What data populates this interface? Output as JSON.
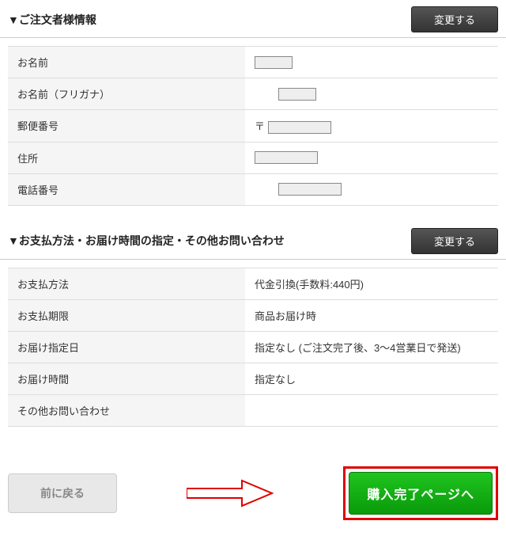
{
  "orderer": {
    "title": "▼ご注文者様情報",
    "change_label": "変更する",
    "rows": {
      "name_label": "お名前",
      "furigana_label": "お名前（フリガナ）",
      "postal_label": "郵便番号",
      "postal_prefix": "〒",
      "address_label": "住所",
      "phone_label": "電話番号"
    }
  },
  "payment": {
    "title": "▼お支払方法・お届け時間の指定・その他お問い合わせ",
    "change_label": "変更する",
    "rows": {
      "method_label": "お支払方法",
      "method_value": "代金引換(手数料:440円)",
      "deadline_label": "お支払期限",
      "deadline_value": "商品お届け時",
      "deliverydate_label": "お届け指定日",
      "deliverydate_value": "指定なし (ご注文完了後、3～4営業日で発送)",
      "deliverytime_label": "お届け時間",
      "deliverytime_value": "指定なし",
      "inquiry_label": "その他お問い合わせ",
      "inquiry_value": ""
    }
  },
  "footer": {
    "back_label": "前に戻る",
    "proceed_label": "購入完了ページへ"
  }
}
